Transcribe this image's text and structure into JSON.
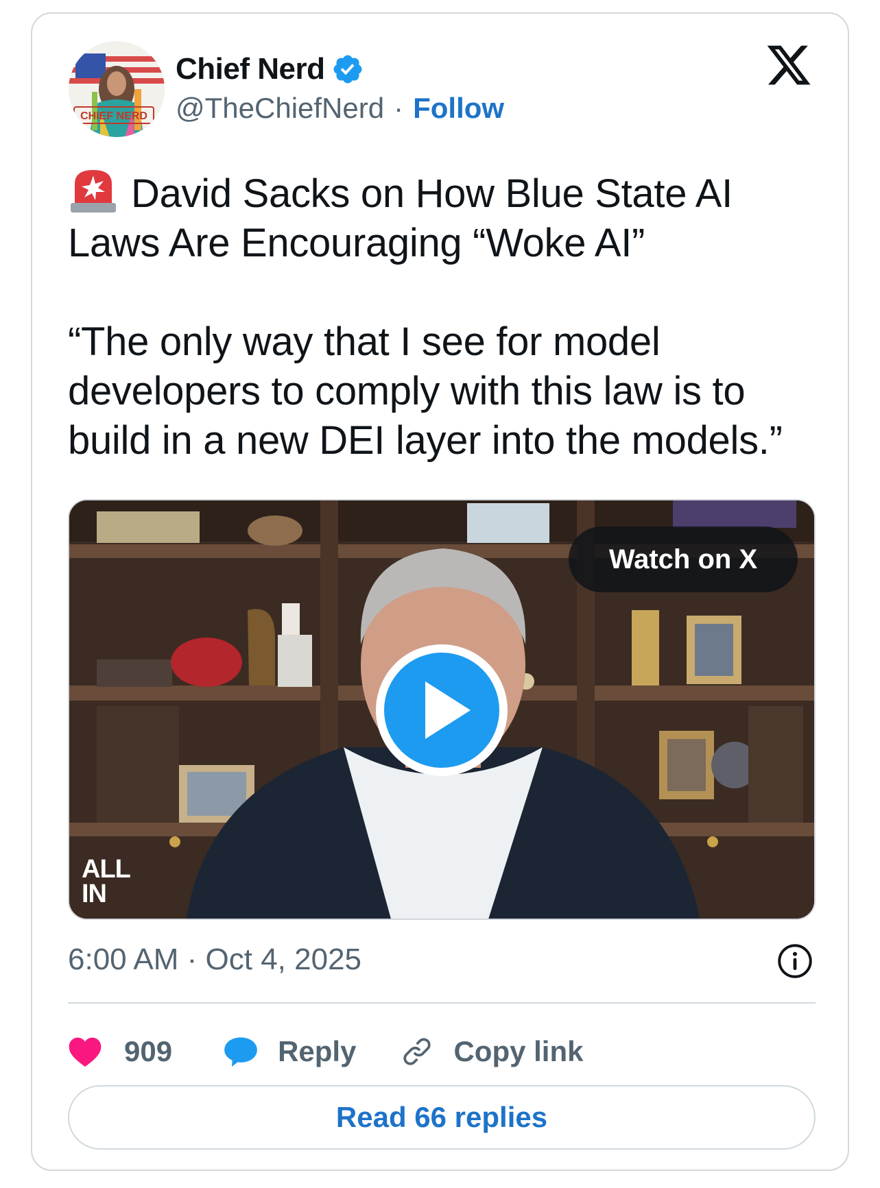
{
  "author": {
    "name": "Chief Nerd",
    "handle": "@TheChiefNerd",
    "separator": "·",
    "follow_label": "Follow",
    "avatar_text": "CHIEF NERD",
    "verified": true
  },
  "post": {
    "title_line": "David Sacks on How Blue State AI Laws Are Encouraging “Woke AI”",
    "quote": "“The only way that I see for model developers to comply with this law is to build in a new DEI layer into the models.”",
    "timestamp": "6:00 AM · Oct 4, 2025"
  },
  "media": {
    "watch_label": "Watch on X",
    "watermark_line1": "ALL",
    "watermark_line2": "IN"
  },
  "actions": {
    "like_count": "909",
    "reply_label": "Reply",
    "copy_label": "Copy link",
    "read_replies_label": "Read 66 replies"
  },
  "colors": {
    "accent": "#1d9bf0",
    "link": "#1d73c8",
    "like": "#f91880",
    "text_secondary": "#536471"
  },
  "icons": [
    "verified-badge-icon",
    "x-logo-icon",
    "siren-icon",
    "play-icon",
    "info-icon",
    "heart-icon",
    "reply-bubble-icon",
    "link-icon"
  ]
}
